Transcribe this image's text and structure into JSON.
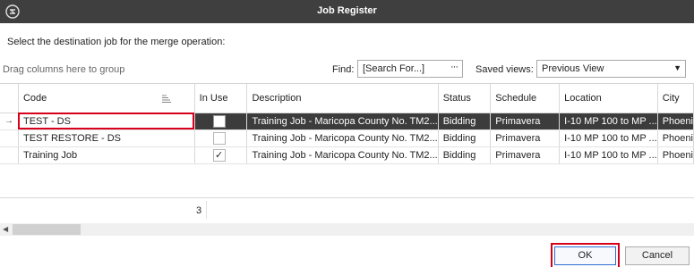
{
  "window": {
    "title": "Job Register",
    "icon": "app-logo-icon"
  },
  "instruction": "Select the destination job for the merge operation:",
  "toolbar": {
    "group_hint": "Drag columns here to group",
    "find_label": "Find:",
    "find_value": "[Search For...]",
    "find_button": "···",
    "saved_views_label": "Saved views:",
    "saved_views_value": "Previous View"
  },
  "grid": {
    "columns": [
      "Code",
      "In Use",
      "Description",
      "Status",
      "Schedule",
      "Location",
      "City"
    ],
    "rows": [
      {
        "indicator": "→",
        "code": "TEST - DS",
        "in_use": false,
        "description": "Training Job - Maricopa County No. TM2...",
        "status": "Bidding",
        "schedule": "Primavera",
        "location": "I-10 MP 100 to MP ...",
        "city": "Phoeni",
        "selected": true
      },
      {
        "indicator": "",
        "code": "TEST RESTORE - DS",
        "in_use": false,
        "description": "Training Job - Maricopa County No. TM2...",
        "status": "Bidding",
        "schedule": "Primavera",
        "location": "I-10 MP 100 to MP ...",
        "city": "Phoeni",
        "selected": false
      },
      {
        "indicator": "",
        "code": "Training Job",
        "in_use": true,
        "description": "Training Job - Maricopa County No. TM2...",
        "status": "Bidding",
        "schedule": "Primavera",
        "location": "I-10 MP 100 to MP ...",
        "city": "Phoeni",
        "selected": false
      }
    ],
    "row_count": "3"
  },
  "buttons": {
    "ok": "OK",
    "cancel": "Cancel"
  },
  "colors": {
    "titlebar": "#3f3f3f",
    "selected_row": "#3c3c3c",
    "highlight": "#d6001c",
    "ok_border": "#2c6dd2"
  }
}
